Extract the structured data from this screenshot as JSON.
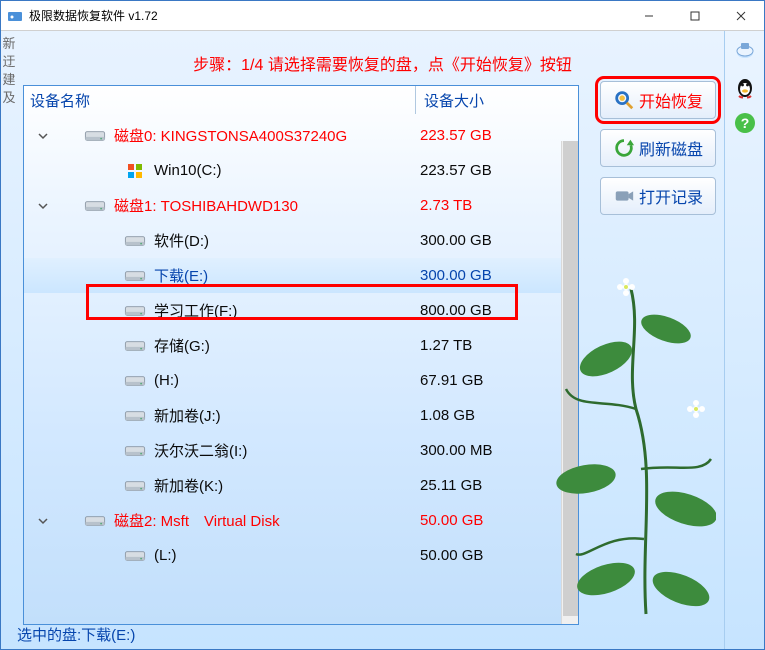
{
  "window": {
    "title": "极限数据恢复软件 v1.72"
  },
  "left_gutter": [
    "新",
    "迂",
    "建",
    "及"
  ],
  "instruction": "步骤：1/4 请选择需要恢复的盘，点《开始恢复》按钮",
  "columns": {
    "name": "设备名称",
    "size": "设备大小"
  },
  "rows": [
    {
      "kind": "disk",
      "chevron": true,
      "indent": 30,
      "name": "磁盘0: KINGSTONSA400S37240G",
      "size": "223.57 GB"
    },
    {
      "kind": "vol",
      "chevron": false,
      "indent": 70,
      "os": true,
      "name": "Win10(C:)",
      "size": "223.57 GB"
    },
    {
      "kind": "disk",
      "chevron": true,
      "indent": 30,
      "name": "磁盘1: TOSHIBAHDWD130",
      "size": "2.73 TB"
    },
    {
      "kind": "vol",
      "chevron": false,
      "indent": 70,
      "name": "软件(D:)",
      "size": "300.00 GB"
    },
    {
      "kind": "vol",
      "chevron": false,
      "indent": 70,
      "name": "下载(E:)",
      "size": "300.00 GB",
      "selected": true
    },
    {
      "kind": "vol",
      "chevron": false,
      "indent": 70,
      "name": "学习工作(F:)",
      "size": "800.00 GB"
    },
    {
      "kind": "vol",
      "chevron": false,
      "indent": 70,
      "name": "存储(G:)",
      "size": "1.27 TB"
    },
    {
      "kind": "vol",
      "chevron": false,
      "indent": 70,
      "name": "(H:)",
      "size": "67.91 GB"
    },
    {
      "kind": "vol",
      "chevron": false,
      "indent": 70,
      "name": "新加卷(J:)",
      "size": "1.08 GB"
    },
    {
      "kind": "vol",
      "chevron": false,
      "indent": 70,
      "name": "沃尔沃二翁(I:)",
      "size": "300.00 MB"
    },
    {
      "kind": "vol",
      "chevron": false,
      "indent": 70,
      "name": "新加卷(K:)",
      "size": "25.11 GB"
    },
    {
      "kind": "disk",
      "chevron": true,
      "indent": 30,
      "name": "磁盘2: Msft　Virtual Disk",
      "size": "50.00 GB"
    },
    {
      "kind": "vol",
      "chevron": false,
      "indent": 70,
      "name": "(L:)",
      "size": "50.00 GB"
    }
  ],
  "buttons": {
    "start": "开始恢复",
    "refresh": "刷新磁盘",
    "openlog": "打开记录"
  },
  "status_prefix": "选中的盘:",
  "status_value": "下载(E:)"
}
